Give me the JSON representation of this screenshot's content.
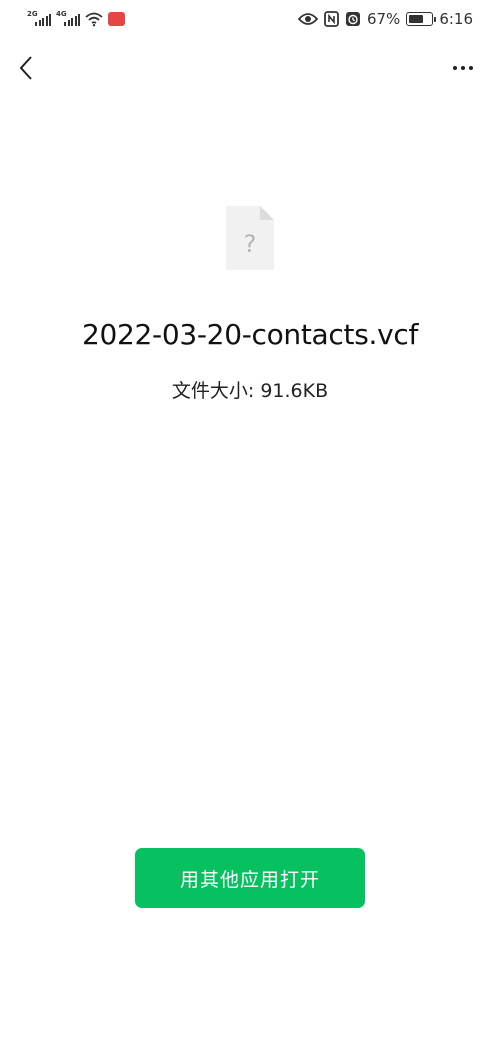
{
  "status_bar": {
    "sim1_network": "2G",
    "sim2_network": "4G",
    "battery_percent": "67%",
    "battery_level": 0.67,
    "time": "6:16"
  },
  "file": {
    "name": "2022-03-20-contacts.vcf",
    "size_text": "文件大小: 91.6KB",
    "icon_glyph": "?"
  },
  "actions": {
    "open_with_other_app": "用其他应用打开"
  },
  "colors": {
    "accent": "#07c160",
    "background": "#ffffff"
  }
}
